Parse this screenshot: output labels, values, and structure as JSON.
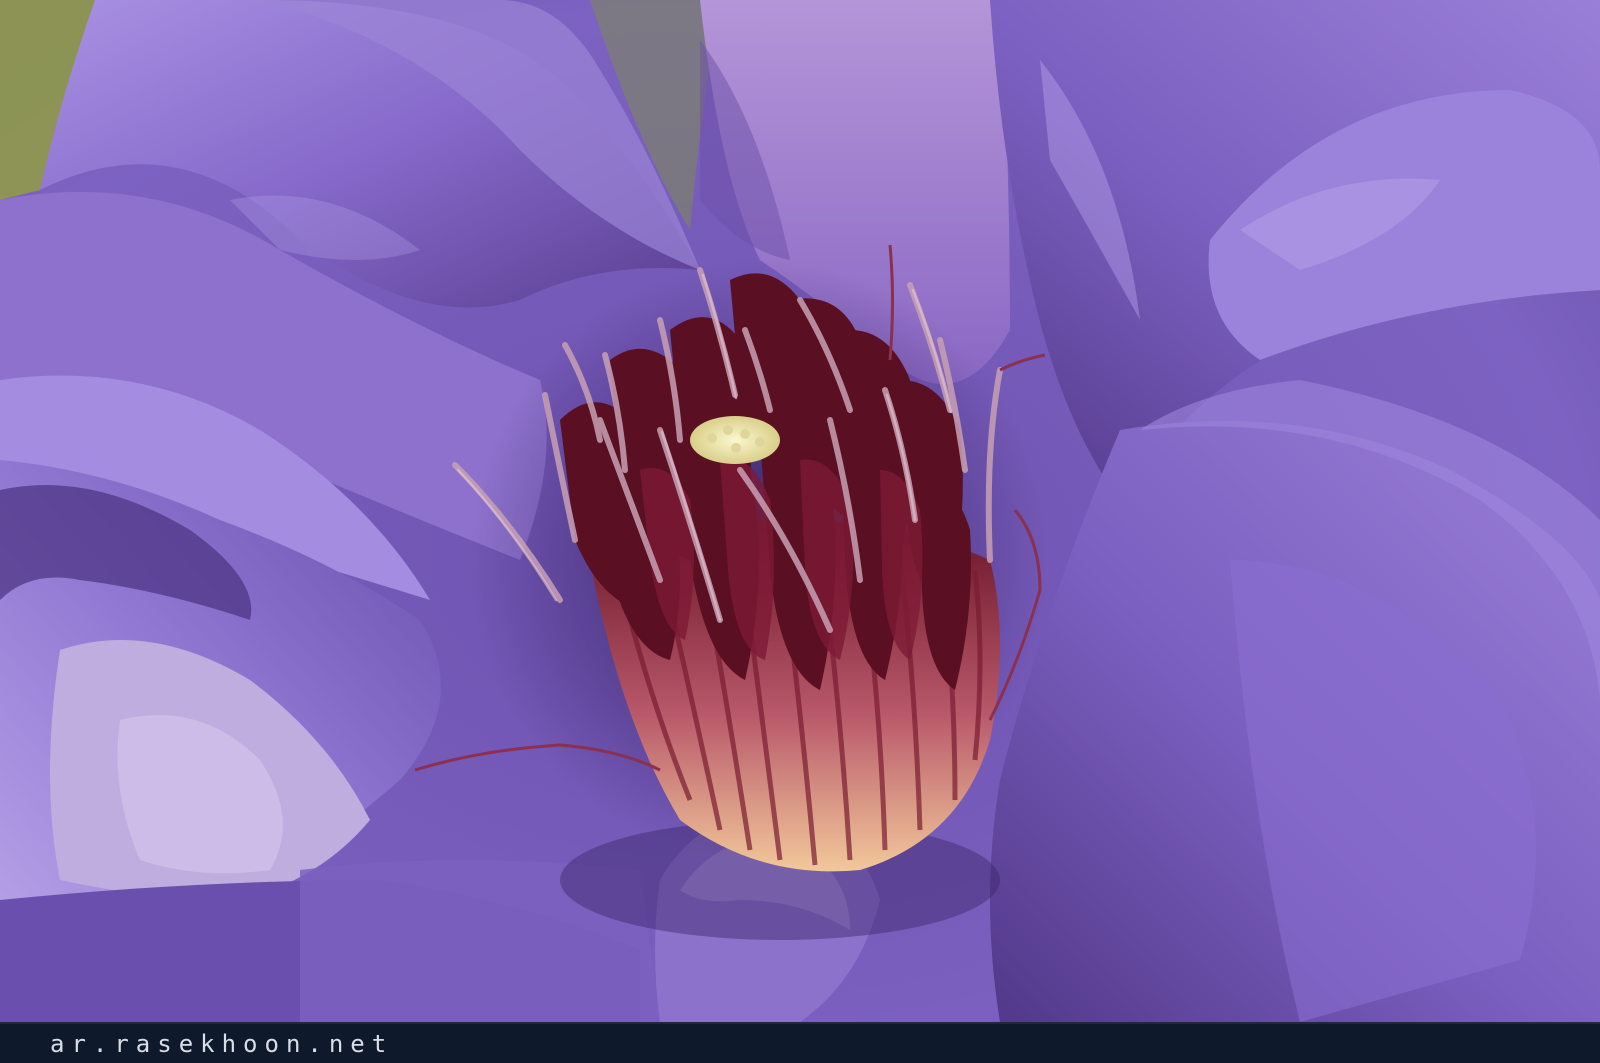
{
  "image": {
    "subject": "clematis-flower-macro",
    "palette": {
      "petal_light": "#a88ce0",
      "petal_mid": "#8467c8",
      "petal_dark": "#4c327a",
      "stamen_maroon": "#5a0f22",
      "stamen_tip": "#c8a0b4",
      "pistil_cream": "#eee8b0",
      "background_green": "#8f9a4a"
    }
  },
  "footer": {
    "watermark": "ar.rasekhoon.net",
    "background": "#0e1a2b",
    "text_color": "#d8dde6"
  }
}
